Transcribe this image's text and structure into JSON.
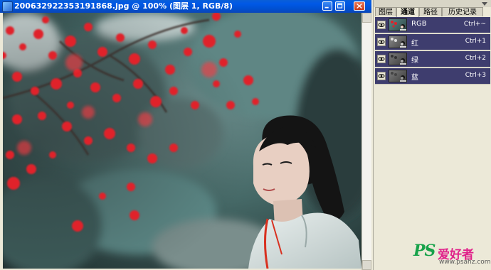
{
  "window": {
    "title": "200632922353191868.jpg @ 100% (图层 1, RGB/8)"
  },
  "palette": {
    "tabs": [
      {
        "label": "图层",
        "active": false
      },
      {
        "label": "通道",
        "active": true
      },
      {
        "label": "路径",
        "active": false
      },
      {
        "label": "历史记录",
        "active": false
      }
    ],
    "channels": [
      {
        "name": "RGB",
        "shortcut": "Ctrl+~",
        "tint": "rgb"
      },
      {
        "name": "红",
        "shortcut": "Ctrl+1",
        "tint": "gray"
      },
      {
        "name": "绿",
        "shortcut": "Ctrl+2",
        "tint": "gray"
      },
      {
        "name": "蓝",
        "shortcut": "Ctrl+3",
        "tint": "gray"
      }
    ]
  },
  "watermark": {
    "logo": "PS",
    "chinese": "爱好者",
    "url": "www.psahz.com"
  },
  "colors": {
    "titlebar": "#0058e6",
    "channel_row": "#3e3d6e",
    "accent_red": "#e0202a",
    "foliage_teal": "#4e7a78"
  },
  "icons": [
    "app-icon",
    "minimize-icon",
    "maximize-icon",
    "close-icon",
    "eye-icon",
    "palette-menu-icon"
  ]
}
